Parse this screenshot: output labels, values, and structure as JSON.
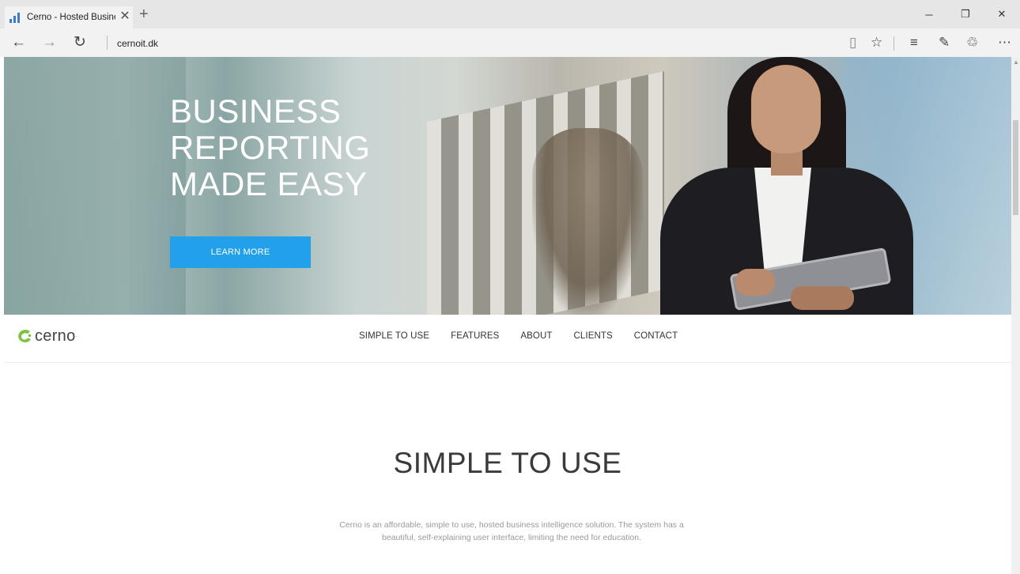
{
  "browser": {
    "tab_title": "Cerno - Hosted Busines",
    "url": "cernoit.dk",
    "icons": {
      "back": "arrow-left",
      "forward": "arrow-right",
      "refresh": "refresh",
      "reading_view": "book",
      "favorites": "star",
      "hub": "lines",
      "web_note": "pen",
      "share": "share",
      "more": "ellipsis"
    }
  },
  "hero": {
    "title_lines": [
      "BUSINESS",
      "REPORTING",
      "MADE EASY"
    ],
    "cta_label": "LEARN MORE",
    "cta_color": "#22a1ea"
  },
  "navbar": {
    "logo_text": "cerno",
    "logo_mark": "·",
    "logo_color": "#7dc242",
    "items": [
      "SIMPLE TO USE",
      "FEATURES",
      "ABOUT",
      "CLIENTS",
      "CONTACT"
    ]
  },
  "section": {
    "title": "SIMPLE TO USE",
    "text": "Cerno is an affordable, simple to use, hosted business intelligence solution. The system has a beautiful, self-explaining user interface, limiting the need for education."
  }
}
